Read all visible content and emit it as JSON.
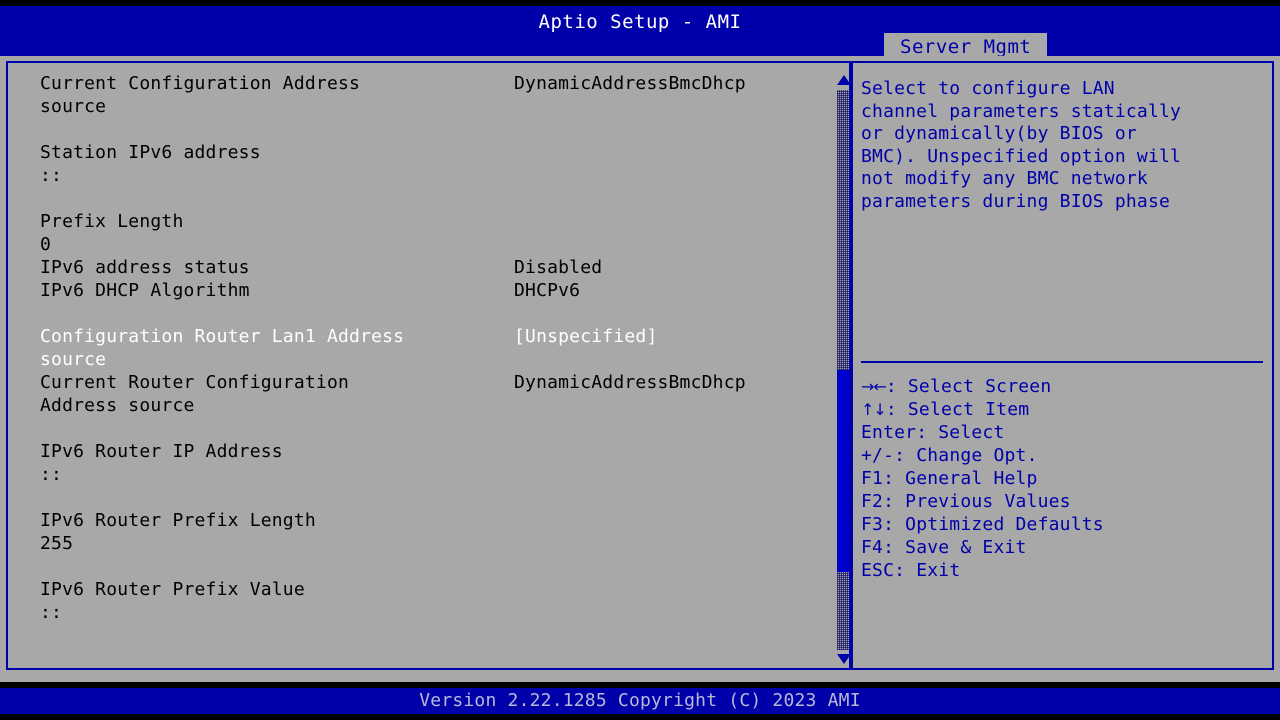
{
  "header": {
    "title": "Aptio Setup - AMI",
    "active_tab": "Server Mgmt",
    "bg_color": "#0000aa",
    "title_color": "#ffffff"
  },
  "colors": {
    "panel_bg": "#a8a8a8",
    "border": "#0000aa",
    "text": "#000000",
    "selected_text": "#ffffff",
    "help_text": "#0000aa"
  },
  "main": {
    "rows": [
      {
        "label": "Current Configuration Address",
        "value": "DynamicAddressBmcDhcp",
        "cont": "source",
        "selected": false
      },
      {
        "spacer": true
      },
      {
        "label": "Station IPv6 address",
        "value": "",
        "cont": "::",
        "selected": false
      },
      {
        "spacer": true
      },
      {
        "label": "Prefix Length",
        "value": "",
        "cont": "0",
        "selected": false
      },
      {
        "label": "IPv6 address status",
        "value": "Disabled",
        "selected": false
      },
      {
        "label": "IPv6 DHCP Algorithm",
        "value": "DHCPv6",
        "selected": false
      },
      {
        "spacer": true
      },
      {
        "label": "Configuration Router Lan1 Address",
        "value": "[Unspecified]",
        "cont": "source",
        "selected": true
      },
      {
        "label": "Current Router Configuration",
        "value": "DynamicAddressBmcDhcp",
        "cont": "Address source",
        "selected": false
      },
      {
        "spacer": true
      },
      {
        "label": "IPv6 Router IP Address",
        "value": "",
        "cont": "::",
        "selected": false
      },
      {
        "spacer": true
      },
      {
        "label": "IPv6 Router Prefix Length",
        "value": "",
        "cont": "255",
        "selected": false
      },
      {
        "spacer": true
      },
      {
        "label": "IPv6 Router Prefix Value",
        "value": "",
        "cont": "::",
        "selected": false
      }
    ]
  },
  "scrollbar": {
    "up_arrow": "scroll-up-arrow-icon",
    "down_arrow": "scroll-down-arrow-icon",
    "thumb_top_pct": 50,
    "thumb_height_pct": 36
  },
  "help": {
    "lines": [
      "Select to configure LAN",
      "channel parameters statically",
      "or dynamically(by BIOS or",
      "BMC). Unspecified option will",
      "not modify any BMC network",
      "parameters during BIOS phase"
    ]
  },
  "keylegend": {
    "items": [
      {
        "glyph": "→←",
        "key": "",
        "sep": ": ",
        "action": "Select Screen"
      },
      {
        "glyph": "↑↓",
        "key": "",
        "sep": ": ",
        "action": "Select Item"
      },
      {
        "glyph": "",
        "key": "Enter",
        "sep": ": ",
        "action": "Select"
      },
      {
        "glyph": "",
        "key": "+/-",
        "sep": ": ",
        "action": "Change Opt."
      },
      {
        "glyph": "",
        "key": "F1",
        "sep": ": ",
        "action": "General Help"
      },
      {
        "glyph": "",
        "key": "F2",
        "sep": ": ",
        "action": "Previous Values"
      },
      {
        "glyph": "",
        "key": "F3",
        "sep": ": ",
        "action": "Optimized Defaults"
      },
      {
        "glyph": "",
        "key": "F4",
        "sep": ": ",
        "action": "Save & Exit"
      },
      {
        "glyph": "",
        "key": "ESC",
        "sep": ": ",
        "action": "Exit"
      }
    ]
  },
  "footer": {
    "text": "Version 2.22.1285 Copyright (C) 2023 AMI"
  }
}
